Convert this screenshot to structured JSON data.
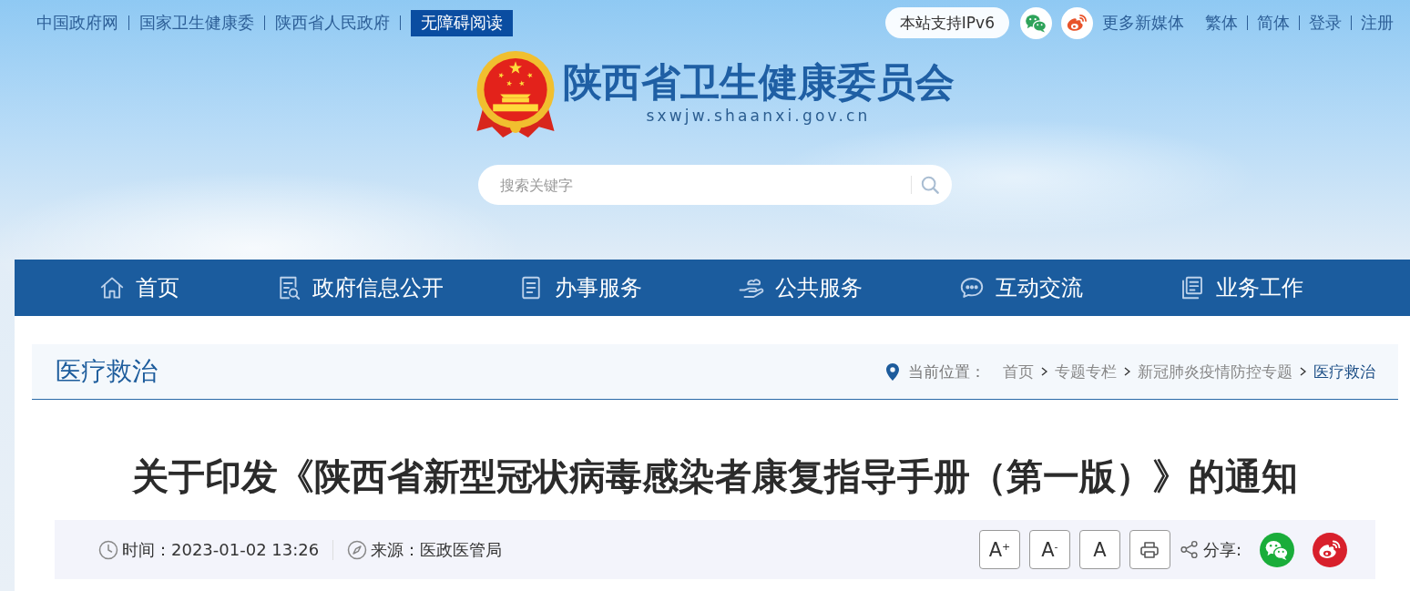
{
  "top_bar": {
    "links": [
      {
        "label": "中国政府网"
      },
      {
        "label": "国家卫生健康委"
      },
      {
        "label": "陕西省人民政府"
      }
    ],
    "accessibility_button": "无障碍阅读",
    "ipv6_badge": "本站支持IPv6",
    "more_media_link": "更多新媒体",
    "utility_links": [
      {
        "label": "繁体"
      },
      {
        "label": "简体"
      },
      {
        "label": "登录"
      },
      {
        "label": "注册"
      }
    ]
  },
  "masthead": {
    "title": "陕西省卫生健康委员会",
    "domain": "sxwjw.shaanxi.gov.cn"
  },
  "search": {
    "placeholder": "搜索关键字"
  },
  "nav": {
    "items": [
      {
        "label": "首页"
      },
      {
        "label": "政府信息公开"
      },
      {
        "label": "办事服务"
      },
      {
        "label": "公共服务"
      },
      {
        "label": "互动交流"
      },
      {
        "label": "业务工作"
      }
    ]
  },
  "section": {
    "title": "医疗救治",
    "breadcrumb": {
      "label": "当前位置：",
      "items": [
        {
          "label": "首页",
          "current": false
        },
        {
          "label": "专题专栏",
          "current": false
        },
        {
          "label": "新冠肺炎疫情防控专题",
          "current": false
        },
        {
          "label": "医疗救治",
          "current": true
        }
      ]
    }
  },
  "article": {
    "title": "关于印发《陕西省新型冠状病毒感染者康复指导手册（第一版）》的通知",
    "time": "时间：2023-01-02 13:26",
    "source": "来源：医政医管局",
    "font_size_buttons": [
      {
        "label": "A$^{+}$"
      },
      {
        "label": "A$^{-}$"
      },
      {
        "label": "A"
      }
    ],
    "share_label": "分享:"
  }
}
